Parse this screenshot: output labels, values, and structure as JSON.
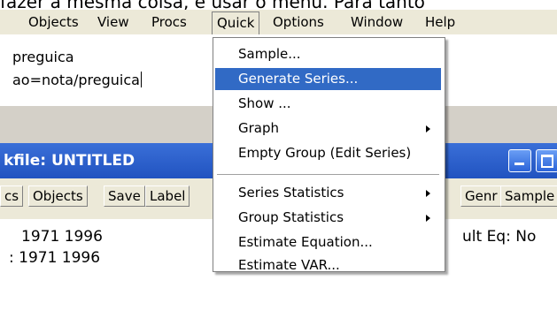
{
  "document": {
    "text": "fazer a mesma coisa, é usar o menu. Para tanto"
  },
  "menubar": {
    "items": [
      {
        "label": "Objects"
      },
      {
        "label": "View"
      },
      {
        "label": "Procs"
      },
      {
        "label": "Quick"
      },
      {
        "label": "Options"
      },
      {
        "label": "Window"
      },
      {
        "label": "Help"
      }
    ]
  },
  "command_window": {
    "lines": [
      "preguica",
      "ao=nota/preguica"
    ]
  },
  "workfile_window": {
    "title": "kfile: UNTITLED",
    "toolbar": [
      "cs",
      "Objects",
      "Save",
      "Label"
    ],
    "toolbar_right": [
      "Genr",
      "Sample"
    ],
    "range_line": "1971 1996",
    "sample_line": ": 1971 1996",
    "default_eq": "ult Eq: No"
  },
  "quick_menu": {
    "items": [
      {
        "label": "Sample...",
        "submenu": false,
        "highlighted": false
      },
      {
        "label": "Generate Series...",
        "submenu": false,
        "highlighted": true
      },
      {
        "label": "Show ...",
        "submenu": false,
        "highlighted": false
      },
      {
        "label": "Graph",
        "submenu": true,
        "highlighted": false
      },
      {
        "label": "Empty Group (Edit Series)",
        "submenu": false,
        "highlighted": false
      },
      {
        "label": "Series Statistics",
        "submenu": true,
        "highlighted": false
      },
      {
        "label": "Group Statistics",
        "submenu": true,
        "highlighted": false
      },
      {
        "label": "Estimate Equation...",
        "submenu": false,
        "highlighted": false
      },
      {
        "label": "Estimate VAR...",
        "submenu": false,
        "highlighted": false
      }
    ]
  },
  "colors": {
    "highlight": "#316ac5",
    "title_bar": "#2153c0",
    "menubar_bg": "#ece9d8"
  }
}
